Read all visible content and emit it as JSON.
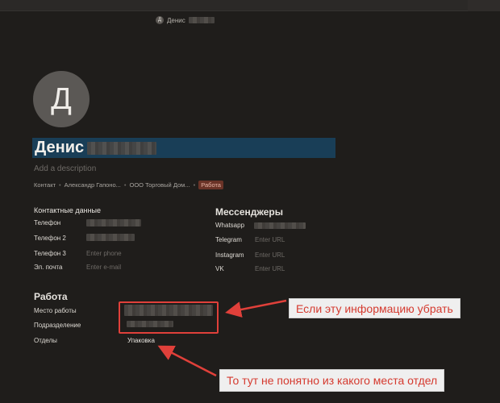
{
  "header": {
    "user_initial": "Д",
    "user_name": "Денис"
  },
  "profile": {
    "avatar_initial": "Д",
    "name": "Денис",
    "description_placeholder": "Add a description"
  },
  "breadcrumbs": [
    {
      "label": "Контакт"
    },
    {
      "label": "Александр Гапоно..."
    },
    {
      "label": "ООО Торговый Дом..."
    },
    {
      "label": "Работа"
    }
  ],
  "contacts": {
    "title": "Контактные данные",
    "rows": [
      {
        "label": "Телефон",
        "value": ""
      },
      {
        "label": "Телефон 2",
        "value": ""
      },
      {
        "label": "Телефон 3",
        "placeholder": "Enter phone"
      },
      {
        "label": "Эл. почта",
        "placeholder": "Enter e-mail"
      }
    ]
  },
  "messengers": {
    "title": "Мессенджеры",
    "rows": [
      {
        "label": "Whatsapp",
        "value": ""
      },
      {
        "label": "Telegram",
        "placeholder": "Enter URL"
      },
      {
        "label": "Instagram",
        "placeholder": "Enter URL"
      },
      {
        "label": "VK",
        "placeholder": "Enter URL"
      }
    ]
  },
  "work": {
    "title": "Работа",
    "rows": [
      {
        "label": "Место работы",
        "value": ""
      },
      {
        "label": "Подразделение",
        "value": ""
      },
      {
        "label": "Отделы",
        "value": "Упаковка"
      }
    ]
  },
  "annotations": {
    "callout_1": "Если эту информацию убрать",
    "callout_2": "То тут не понятно из какого места отдел",
    "color": "#e0403a"
  }
}
